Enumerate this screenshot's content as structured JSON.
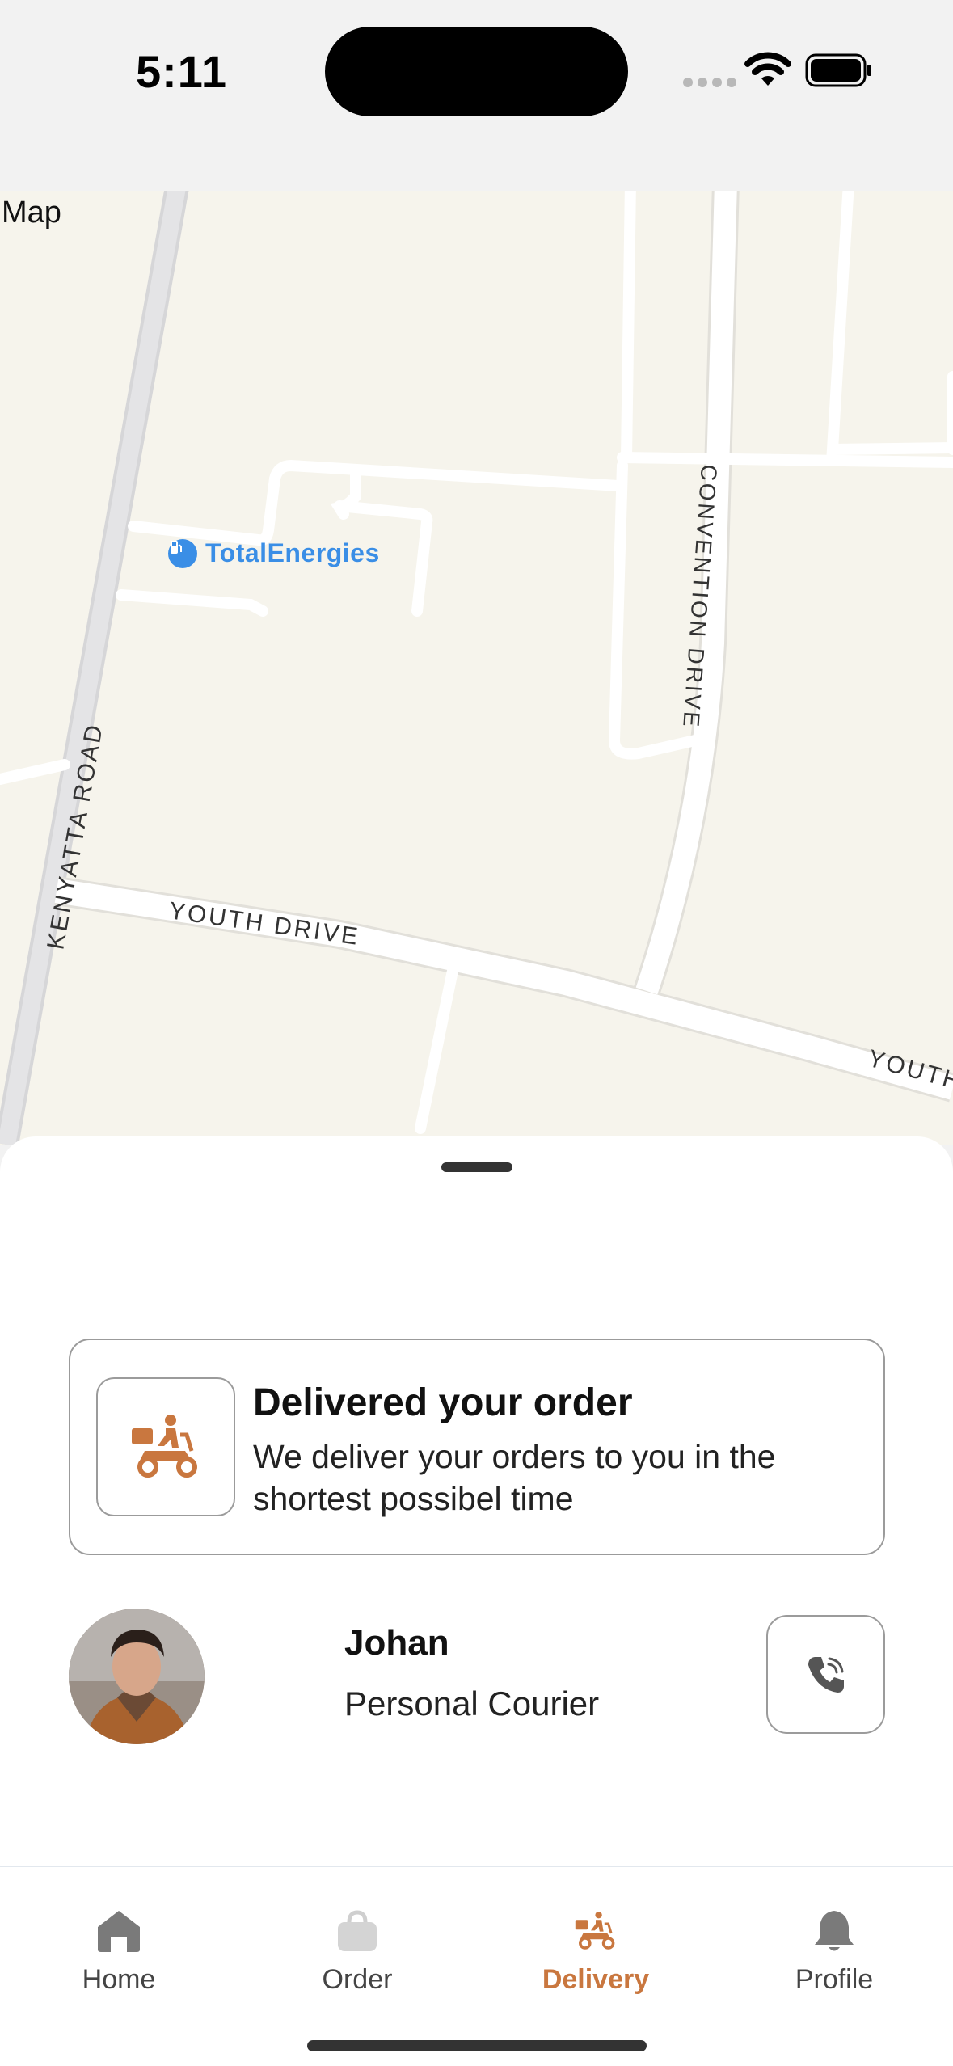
{
  "status_bar": {
    "time": "5:11"
  },
  "map": {
    "label": "Map",
    "poi_label": "TotalEnergies",
    "roads": {
      "kenyatta": "KENYATTA ROAD",
      "youth": "YOUTH DRIVE",
      "youth_partial": "YOUTH",
      "convention": "CONVENTION DRIVE"
    }
  },
  "delivery_card": {
    "title": "Delivered your order",
    "description": "We deliver your orders to you in the shortest possibel time"
  },
  "courier": {
    "name": "Johan",
    "role": "Personal Courier"
  },
  "tabs": [
    {
      "label": "Home",
      "icon": "home-icon",
      "active": false
    },
    {
      "label": "Order",
      "icon": "bag-icon",
      "active": false
    },
    {
      "label": "Delivery",
      "icon": "scooter-icon",
      "active": true
    },
    {
      "label": "Profile",
      "icon": "bell-icon",
      "active": false
    }
  ],
  "colors": {
    "accent": "#c9773f",
    "map_bg": "#f6f4ec",
    "poi_blue": "#3a8ee6",
    "border": "#9b9b9b"
  }
}
